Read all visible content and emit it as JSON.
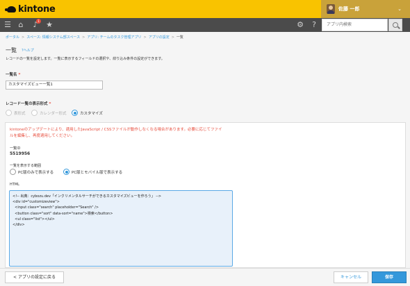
{
  "header": {
    "logo_text": "kintone",
    "user_name": "佐藤 一郎",
    "user_chevron": "⌄",
    "notification_count": "1",
    "search_placeholder": "アプリ内検索"
  },
  "icons": {
    "menu": "menu-icon",
    "home": "home-icon",
    "bell": "bell-icon",
    "star": "star-icon",
    "gear": "gear-icon",
    "help": "help-icon",
    "search": "search-icon"
  },
  "breadcrumb": {
    "items": [
      "ポータル",
      "スペース: 情報システム部スペース",
      "アプリ: チームのタスク管理アプリ",
      "アプリの設定"
    ],
    "current": "一覧",
    "separator": ">"
  },
  "page": {
    "title": "一覧",
    "help": "?ヘルプ",
    "description": "レコードの一覧を設定します。一覧に表示するフィールドの選択や、絞り込み条件の設定ができます。"
  },
  "form": {
    "name_label": "一覧名",
    "required_mark": "*",
    "name_value": "カスタマイズビュー一覧1",
    "format_label": "レコード一覧の表示形式",
    "formats": [
      "表形式",
      "カレンダー形式",
      "カスタマイズ"
    ],
    "selected_format": "カスタマイズ",
    "warning": "kintoneのアップデートにより、適用したJavaScript / CSSファイルが動作しなくなる場合があります。必要に応じてファイルを編集し、再度適用してください。",
    "view_id_label": "一覧ID",
    "view_id": "5519956",
    "scope_label": "一覧を表示する範囲",
    "scopes": [
      "PC版のみで表示する",
      "PC版とモバイル版で表示する"
    ],
    "selected_scope": "PC版とモバイル版で表示する",
    "html_label": "HTML",
    "html_value": "<!-- 出典：cybozu.dev「インクリメンタルサーチができるカスタマイズビューを作ろう」 -->\n<div id=\"customizeview\">\n  <input class=\"search\" placeholder=\"Search\" />\n  <button class=\"sort\" data-sort=\"name\">検索</button>\n  <ul class=\"list\"></ul>\n</div>"
  },
  "footer": {
    "back": "< アプリの設定に戻る",
    "cancel": "キャンセル",
    "save": "保存"
  },
  "colors": {
    "header_yellow": "#f9c300",
    "nav_gray": "#4b4b4b",
    "accent_blue": "#3498db",
    "warning_red": "#e74c3c"
  }
}
